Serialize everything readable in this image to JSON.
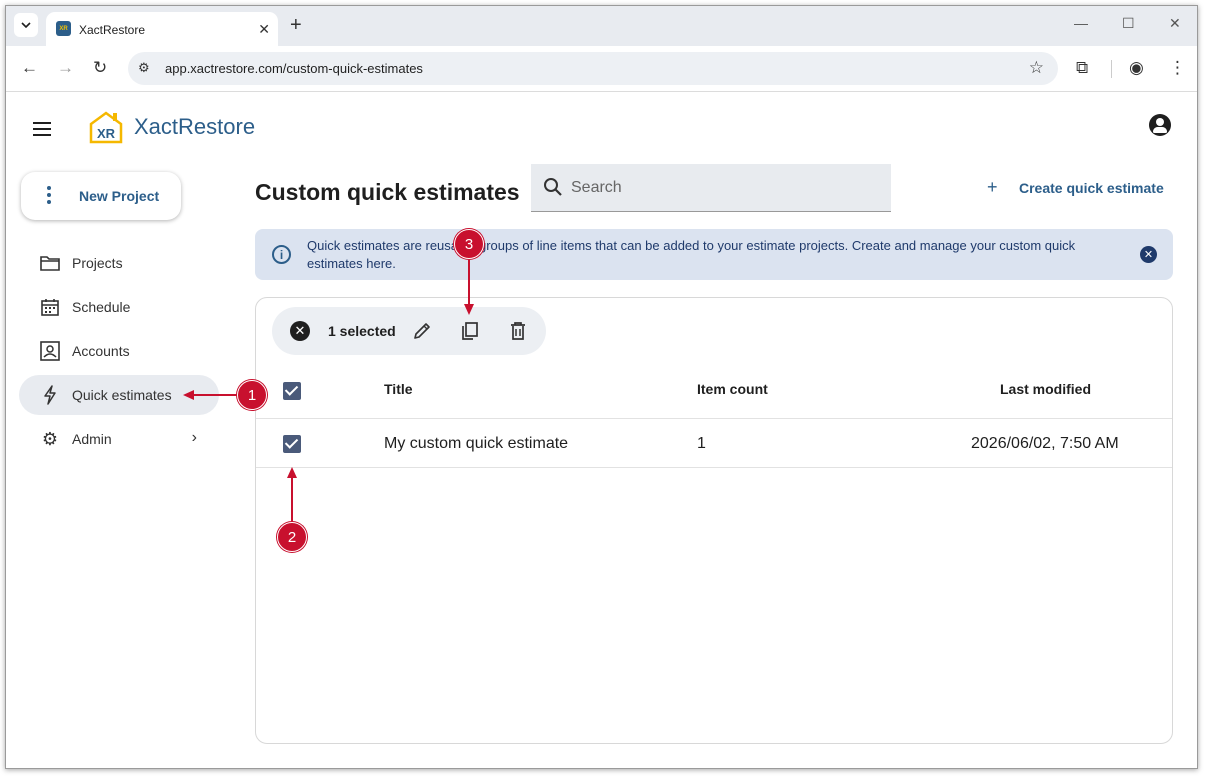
{
  "browser": {
    "tab_title": "XactRestore",
    "url": "app.xactrestore.com/custom-quick-estimates",
    "favicon_text": "XR"
  },
  "app": {
    "brand_text": "XactRestore",
    "logo_text": "XR",
    "brand_color": "#2c5e8a",
    "accent_color": "#f5b800"
  },
  "sidebar": {
    "new_project_label": "New Project",
    "items": [
      {
        "label": "Projects",
        "icon": "folder-icon"
      },
      {
        "label": "Schedule",
        "icon": "calendar-icon"
      },
      {
        "label": "Accounts",
        "icon": "contact-card-icon"
      },
      {
        "label": "Quick estimates",
        "icon": "lightning-icon",
        "active": true
      },
      {
        "label": "Admin",
        "icon": "gear-icon"
      }
    ]
  },
  "main": {
    "title": "Custom quick estimates",
    "search_placeholder": "Search",
    "create_label": "Create quick estimate",
    "banner_text": "Quick estimates are reusable groups of line items that can be added to your estimate projects. Create and manage your custom quick estimates here.",
    "selection": {
      "count_label": "1 selected"
    },
    "table": {
      "columns": [
        "Title",
        "Item count",
        "Last modified"
      ],
      "rows": [
        {
          "title": "My custom quick estimate",
          "item_count": "1",
          "last_modified": "2026/06/02, 7:50 AM",
          "checked": true
        }
      ]
    }
  },
  "annotations": {
    "markers": [
      "1",
      "2",
      "3"
    ],
    "color": "#c8102e"
  }
}
